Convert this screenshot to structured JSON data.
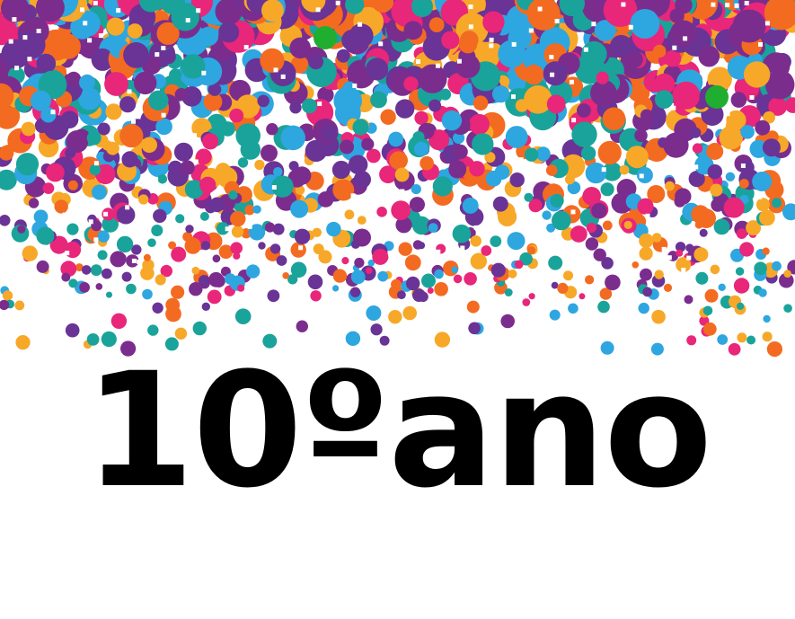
{
  "title": "10ºano",
  "colors": {
    "text": "#000000",
    "background": "#ffffff",
    "confetti": [
      "#7b2d8e",
      "#e8267a",
      "#1aa39a",
      "#f7a828",
      "#2ea6e0",
      "#f36b21",
      "#6a3396"
    ],
    "accent_green": "#1fae2f"
  }
}
